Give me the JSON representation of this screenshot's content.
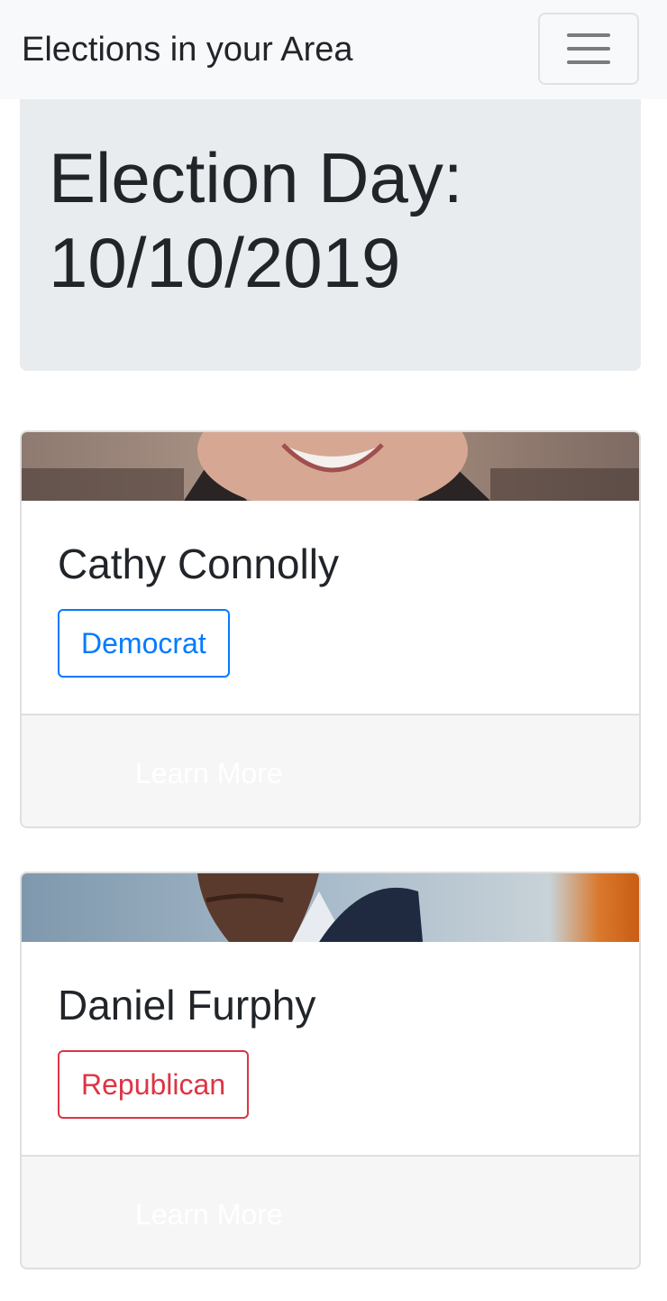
{
  "navbar": {
    "brand": "Elections in your Area",
    "toggler_icon": "hamburger-menu-icon"
  },
  "jumbotron": {
    "title": "Election Day: 10/10/2019"
  },
  "candidates": [
    {
      "name": "Cathy Connolly",
      "party": "Democrat",
      "party_color": "#007bff",
      "button": "Learn More"
    },
    {
      "name": "Daniel Furphy",
      "party": "Republican",
      "party_color": "#dc3545",
      "button": "Learn More"
    }
  ]
}
